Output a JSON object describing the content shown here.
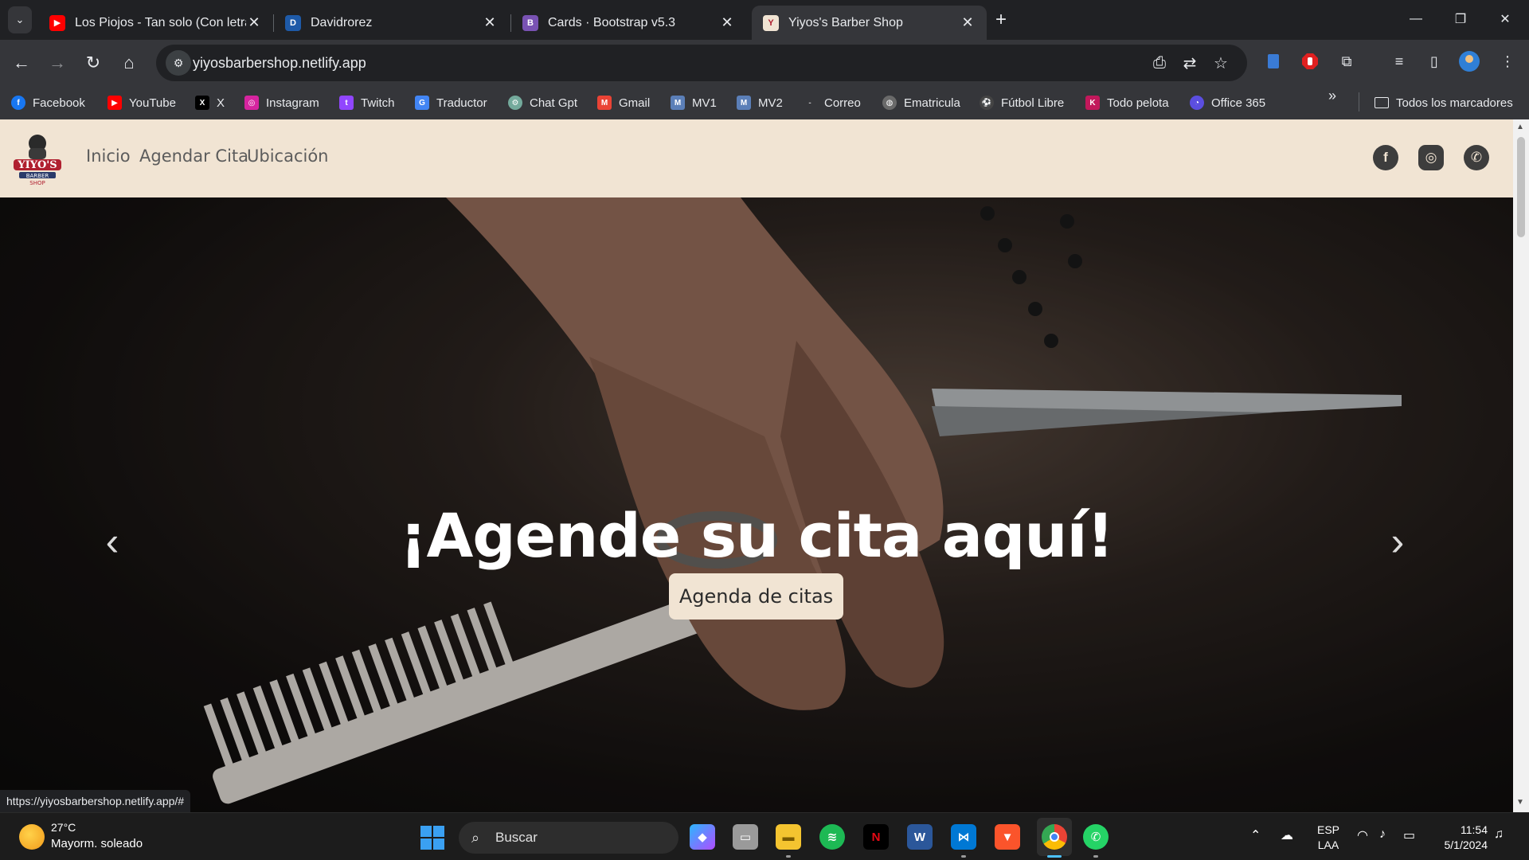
{
  "tabs": [
    {
      "title": "Los Piojos - Tan solo (Con letra)",
      "favicon": "youtube-icon",
      "color": "#ff0000"
    },
    {
      "title": "Davidrorez",
      "favicon": "drz-icon",
      "color": "#1e5aa8"
    },
    {
      "title": "Cards · Bootstrap v5.3",
      "favicon": "bootstrap-icon",
      "color": "#7952b3"
    },
    {
      "title": "Yiyos's Barber Shop",
      "favicon": "yiyos-icon",
      "color": "#b02030"
    }
  ],
  "address": {
    "url": "yiyosbarbershop.netlify.app"
  },
  "bookmarks": [
    {
      "label": "Facebook",
      "icon": "facebook-icon",
      "color": "#1877f2",
      "glyph": "f"
    },
    {
      "label": "YouTube",
      "icon": "youtube-icon",
      "color": "#ff0000",
      "glyph": "▶"
    },
    {
      "label": "X",
      "icon": "x-icon",
      "color": "#000000",
      "glyph": "X"
    },
    {
      "label": "Instagram",
      "icon": "instagram-icon",
      "color": "#d6249f",
      "glyph": "◎"
    },
    {
      "label": "Twitch",
      "icon": "twitch-icon",
      "color": "#9146ff",
      "glyph": "t"
    },
    {
      "label": "Traductor",
      "icon": "translate-icon",
      "color": "#4285f4",
      "glyph": "G"
    },
    {
      "label": "Chat Gpt",
      "icon": "chatgpt-icon",
      "color": "#74aa9c",
      "glyph": "⚙"
    },
    {
      "label": "Gmail",
      "icon": "gmail-icon",
      "color": "#ea4335",
      "glyph": "M"
    },
    {
      "label": "MV1",
      "icon": "moodle-icon",
      "color": "#5b7fb8",
      "glyph": "M"
    },
    {
      "label": "MV2",
      "icon": "moodle-icon",
      "color": "#5b7fb8",
      "glyph": "M"
    },
    {
      "label": "Correo",
      "icon": "mail-icon",
      "color": "#35363a",
      "glyph": "-"
    },
    {
      "label": "Ematricula",
      "icon": "globe-icon",
      "color": "#6a6a6a",
      "glyph": "◍"
    },
    {
      "label": "Fútbol Libre",
      "icon": "soccer-icon",
      "color": "#444444",
      "glyph": "⚽"
    },
    {
      "label": "Todo pelota",
      "icon": "todo-pelota-icon",
      "color": "#c2185b",
      "glyph": "K"
    },
    {
      "label": "Office 365",
      "icon": "office-icon",
      "color": "#5b4ee0",
      "glyph": "◔"
    }
  ],
  "bookmarks_all": "Todos los marcadores",
  "site": {
    "nav": [
      "Inicio",
      "Agendar Cita",
      "Ubicación"
    ],
    "hero_title": "¡Agende su cita aquí!",
    "cta": "Agenda de citas",
    "social": [
      "facebook-icon",
      "instagram-icon",
      "whatsapp-icon"
    ]
  },
  "status_url": "https://yiyosbarbershop.netlify.app/#",
  "taskbar": {
    "temp": "27°C",
    "weather": "Mayorm. soleado",
    "search": "Buscar",
    "lang1": "ESP",
    "lang2": "LAA",
    "time": "11:54",
    "date": "5/1/2024"
  },
  "colors": {
    "accent": "#f1e4d3",
    "chrome": "#35363a",
    "tabstrip": "#202124"
  }
}
